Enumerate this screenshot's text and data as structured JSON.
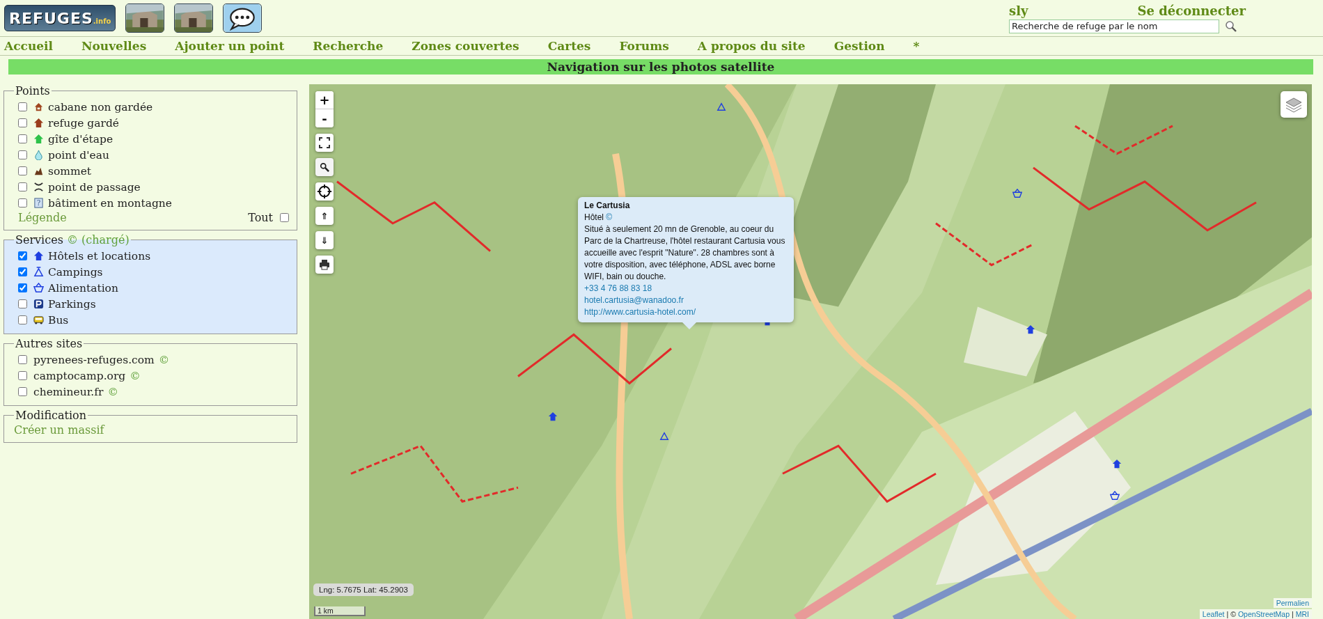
{
  "header": {
    "logo": {
      "name": "REFUGES",
      "suffix": ".info"
    },
    "thumbnails": [
      {
        "kind": "picture"
      },
      {
        "kind": "picture"
      },
      {
        "kind": "chat"
      }
    ],
    "user": "sly",
    "logout": "Se déconnecter",
    "search": {
      "placeholder": "Recherche de refuge par le nom"
    }
  },
  "menu": [
    "Accueil",
    "Nouvelles",
    "Ajouter un point",
    "Recherche",
    "Zones couvertes",
    "Cartes",
    "Forums",
    "A propos du site",
    "Gestion",
    "*"
  ],
  "page_title": "Navigation sur les photos satellite",
  "points": {
    "legend": "Points",
    "items": [
      {
        "label": "cabane non gardée",
        "kind": "cabane",
        "checked": false
      },
      {
        "label": "refuge gardé",
        "kind": "refuge",
        "checked": false
      },
      {
        "label": "gîte d'étape",
        "kind": "gite",
        "checked": false
      },
      {
        "label": "point d'eau",
        "kind": "eau",
        "checked": false
      },
      {
        "label": "sommet",
        "kind": "sommet",
        "checked": false
      },
      {
        "label": "point de passage",
        "kind": "passage",
        "checked": false
      },
      {
        "label": "bâtiment en montagne",
        "kind": "batiment",
        "glyph": "?",
        "checked": false
      }
    ],
    "legend_link": "Légende",
    "all_label": "Tout",
    "all_checked": false
  },
  "services": {
    "legend": "Services",
    "legend_extra": "© (chargé)",
    "items": [
      {
        "label": "Hôtels et locations",
        "kind": "hotel",
        "checked": true
      },
      {
        "label": "Campings",
        "kind": "camping",
        "checked": true
      },
      {
        "label": "Alimentation",
        "kind": "alimentation",
        "checked": true
      },
      {
        "label": "Parkings",
        "kind": "parking",
        "checked": false
      },
      {
        "label": "Bus",
        "kind": "bus",
        "checked": false
      }
    ]
  },
  "other_sites": {
    "legend": "Autres sites",
    "items": [
      {
        "label": "pyrenees-refuges.com",
        "mark": "©",
        "checked": false
      },
      {
        "label": "camptocamp.org",
        "mark": "©",
        "checked": false
      },
      {
        "label": "chemineur.fr",
        "mark": "©",
        "checked": false
      }
    ]
  },
  "modification": {
    "legend": "Modification",
    "link": "Créer un massif"
  },
  "map": {
    "zoom_in": "+",
    "zoom_out": "-",
    "up": "⇑",
    "down": "⇓",
    "popup": {
      "title": "Le Cartusia",
      "type": "Hôtel",
      "type_mark": "©",
      "description": "Situé à seulement 20 mn de Grenoble, au coeur du Parc de la Chartreuse, l'hôtel restaurant Cartusia vous accueille avec l'esprit \"Nature\". 28 chambres sont à votre disposition, avec téléphone, ADSL avec borne WIFI, bain ou douche.",
      "phone": "+33 4 76 88 83 18",
      "email": "hotel.cartusia@wanadoo.fr",
      "url": "http://www.cartusia-hotel.com/"
    },
    "coordinates": "Lng: 5.7675 Lat: 45.2903",
    "scale": "1 km",
    "permalink": "Permalien",
    "attribution": {
      "links": [
        "Leaflet",
        "OpenStreetMap",
        "MRI"
      ],
      "separator": "|",
      "copyright": "©"
    }
  }
}
